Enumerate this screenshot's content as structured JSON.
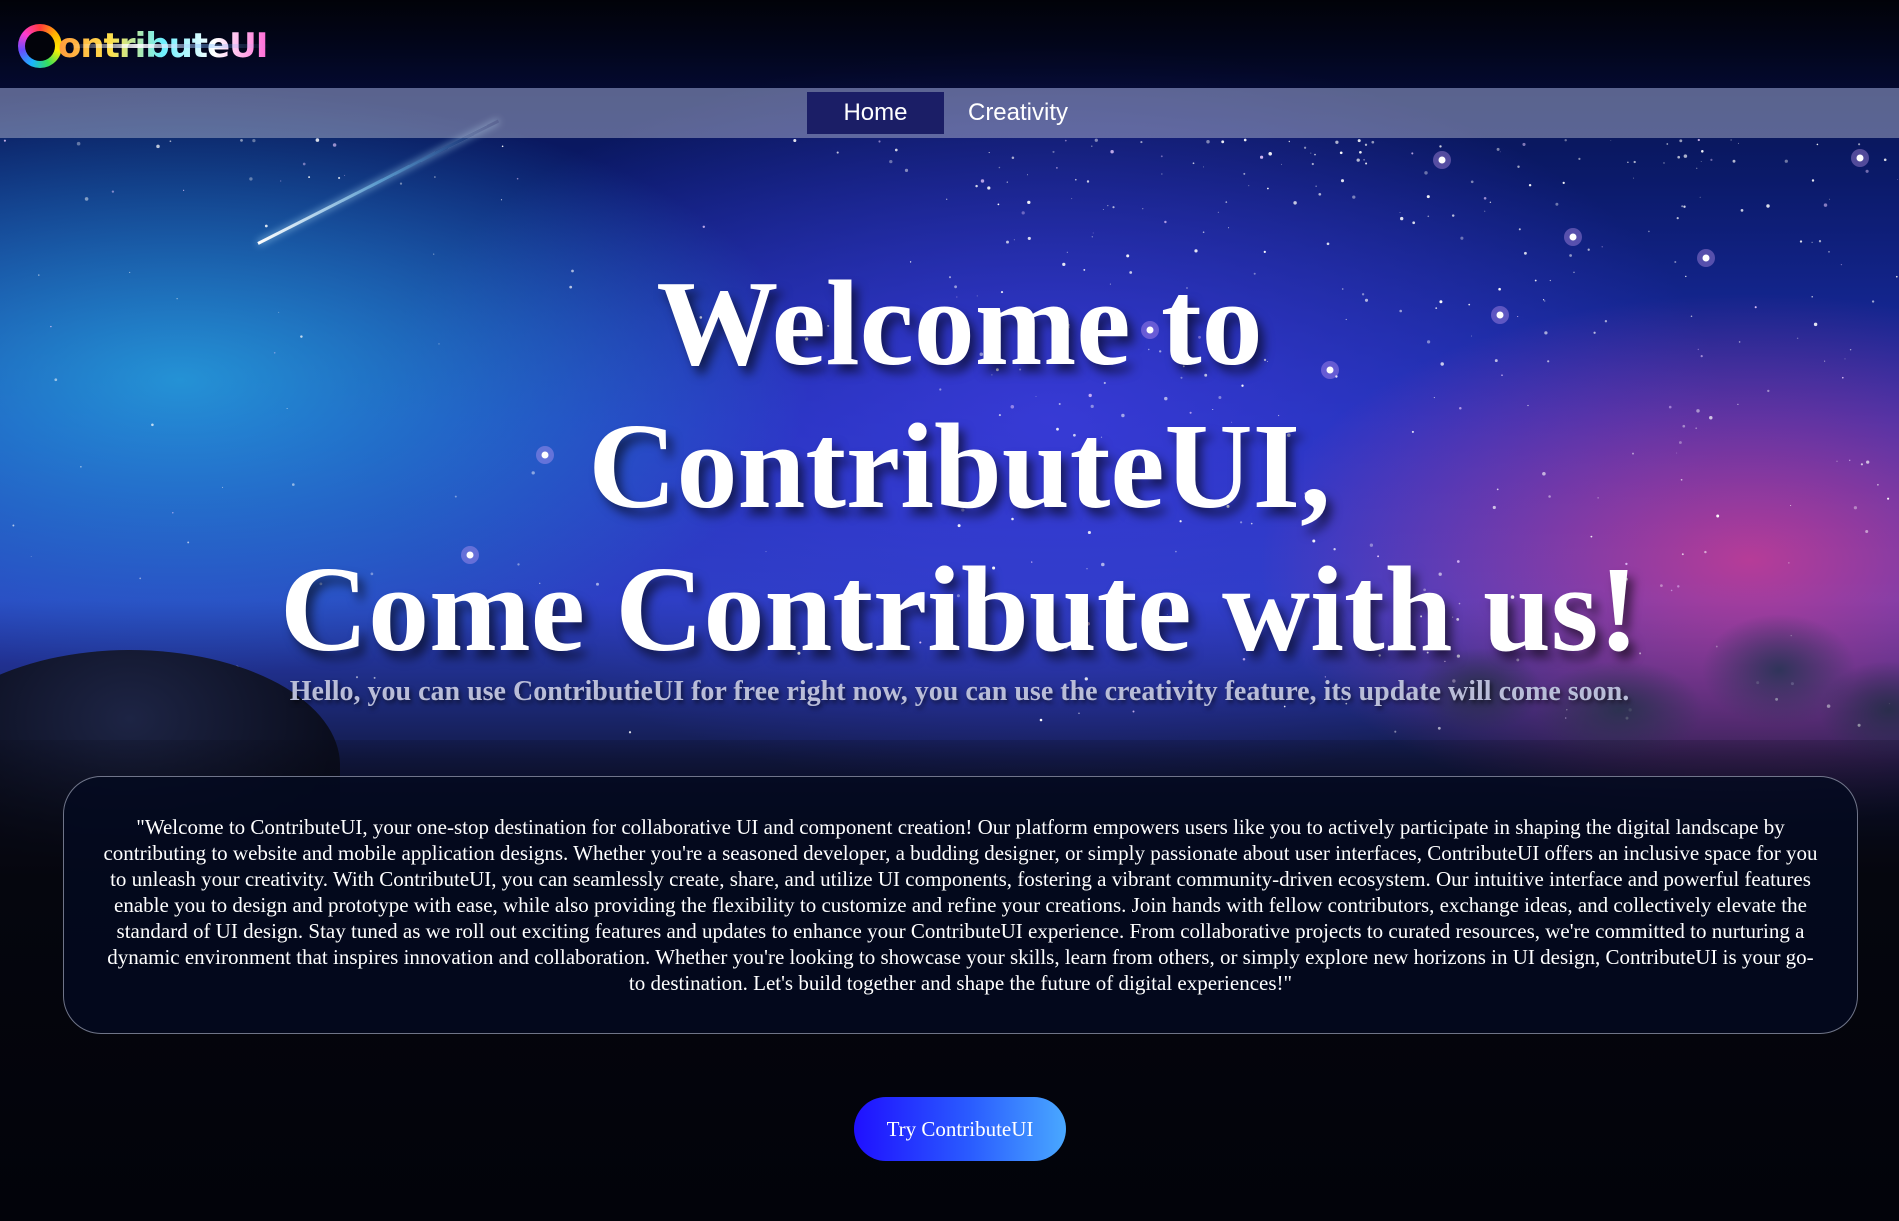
{
  "brand": {
    "logo_text": "ontribute",
    "logo_suffix": "UI"
  },
  "nav": {
    "items": [
      {
        "label": "Home",
        "active": true
      },
      {
        "label": "Creativity",
        "active": false
      }
    ]
  },
  "hero": {
    "line1": "Welcome to",
    "line2": "ContributeUI,",
    "line3": "Come Contribute with us!",
    "subtitle": "Hello, you can use ContributieUI for free right now, you can use the creativity feature, its update will come soon."
  },
  "about": {
    "text": "\"Welcome to ContributeUI, your one-stop destination for collaborative UI and component creation! Our platform empowers users like you to actively participate in shaping the digital landscape by contributing to website and mobile application designs. Whether you're a seasoned developer, a budding designer, or simply passionate about user interfaces, ContributeUI offers an inclusive space for you to unleash your creativity. With ContributeUI, you can seamlessly create, share, and utilize UI components, fostering a vibrant community-driven ecosystem. Our intuitive interface and powerful features enable you to design and prototype with ease, while also providing the flexibility to customize and refine your creations. Join hands with fellow contributors, exchange ideas, and collectively elevate the standard of UI design. Stay tuned as we roll out exciting features and updates to enhance your ContributeUI experience. From collaborative projects to curated resources, we're committed to nurturing a dynamic environment that inspires innovation and collaboration. Whether you're looking to showcase your skills, learn from others, or simply explore new horizons in UI design, ContributeUI is your go-to destination. Let's build together and shape the future of digital experiences!\""
  },
  "cta": {
    "label": "Try ContributeUI"
  },
  "colors": {
    "nav_active_bg": "#1b1e66",
    "cta_gradient_start": "#1f10ff",
    "cta_gradient_end": "#49a8ff",
    "card_bg": "#040a20"
  }
}
